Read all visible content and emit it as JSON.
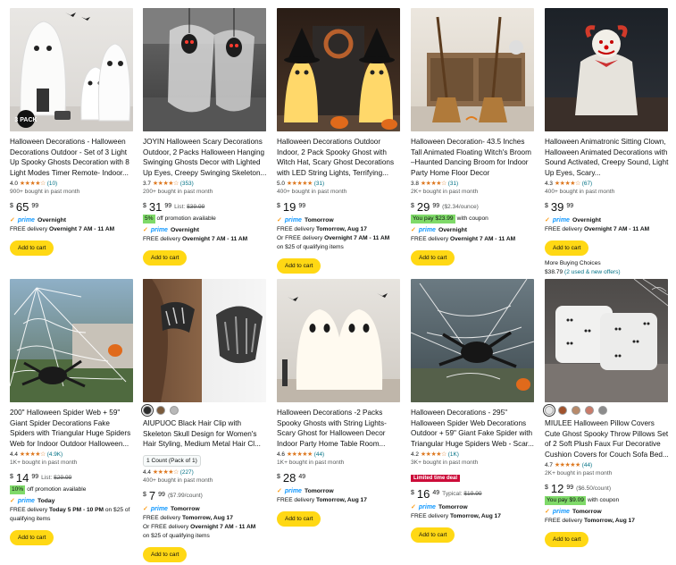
{
  "cards": [
    {
      "title": "Halloween Decorations - Halloween Decorations Outdoor - Set of 3 Light Up Spooky Ghosts Decoration with 8 Light Modes Timer Remote- Indoor...",
      "rating": "4.0",
      "stars": "★★★★☆",
      "reviews": "(10)",
      "bought": "900+ bought in past month",
      "price": {
        "sym": "$",
        "whole": "65",
        "frac": "99"
      },
      "prime": "Overnight",
      "delivery": [
        "FREE delivery ",
        "Overnight 7 AM - 11 AM"
      ],
      "cart": "Add to cart",
      "badge": "3 PACK"
    },
    {
      "title": "JOYIN Halloween Scary Decorations Outdoor, 2 Packs Halloween Hanging Swinging Ghosts Decor with Lighted Up Eyes, Creepy Swinging Skeleton...",
      "rating": "3.7",
      "stars": "★★★★☆",
      "reviews": "(353)",
      "bought": "200+ bought in past month",
      "price": {
        "sym": "$",
        "whole": "31",
        "frac": "99",
        "list": "List: ",
        "list_price": "$39.99"
      },
      "promo": {
        "badge": "5%",
        "text": "off promotion available"
      },
      "prime": "Overnight",
      "delivery": [
        "FREE delivery ",
        "Overnight 7 AM - 11 AM"
      ],
      "cart": "Add to cart"
    },
    {
      "title": "Halloween Decorations Outdoor Indoor, 2 Pack Spooky Ghost with Witch Hat, Scary Ghost Decorations with LED String Lights, Terrifying...",
      "rating": "5.0",
      "stars": "★★★★★",
      "reviews": "(31)",
      "bought": "400+ bought in past month",
      "price": {
        "sym": "$",
        "whole": "19",
        "frac": "99"
      },
      "prime": "Tomorrow",
      "delivery": [
        "FREE delivery ",
        "Tomorrow, Aug 17"
      ],
      "delivery2": [
        "Or FREE delivery ",
        "Overnight 7 AM - 11 AM"
      ],
      "delivery3": "on $25 of qualifying items",
      "cart": "Add to cart"
    },
    {
      "title": "Halloween Decoration- 43.5 Inches Tall Animated Floating Witch's Broom –Haunted Dancing Broom for Indoor Party Home Floor Decor",
      "rating": "3.8",
      "stars": "★★★★☆",
      "reviews": "(31)",
      "bought": "2K+ bought in past month",
      "price": {
        "sym": "$",
        "whole": "29",
        "frac": "99",
        "note": "($2.34/ounce)"
      },
      "promo": {
        "badge": "You pay $23.99",
        "text": "with coupon"
      },
      "prime": "Overnight",
      "delivery": [
        "FREE delivery ",
        "Overnight 7 AM - 11 AM"
      ],
      "cart": "Add to cart"
    },
    {
      "title": "Halloween Animatronic Sitting Clown, Halloween Animated Decorations with Sound Activated, Creepy Sound, Light Up Eyes, Scary...",
      "rating": "4.3",
      "stars": "★★★★☆",
      "reviews": "(67)",
      "bought": "400+ bought in past month",
      "price": {
        "sym": "$",
        "whole": "39",
        "frac": "99"
      },
      "prime": "Overnight",
      "delivery": [
        "FREE delivery ",
        "Overnight 7 AM - 11 AM"
      ],
      "cart": "Add to cart",
      "more_label": "More Buying Choices",
      "more_price": "$38.79",
      "more_link": "(2 used & new offers)"
    },
    {
      "title": "200\" Halloween Spider Web + 59\" Giant Spider Decorations Fake Spiders with Triangular Huge Spiders Web for Indoor Outdoor Halloween...",
      "rating": "4.4",
      "stars": "★★★★☆",
      "reviews": "(4.9K)",
      "bought": "1K+ bought in past month",
      "price": {
        "sym": "$",
        "whole": "14",
        "frac": "99",
        "list": "List: ",
        "list_price": "$29.99"
      },
      "promo": {
        "badge": "10%",
        "text": "off promotion available"
      },
      "prime": "Today",
      "delivery": [
        "FREE delivery ",
        "Today 5 PM - 10 PM"
      ],
      "delivery_tail": " on $25 of qualifying items",
      "cart": "Add to cart"
    },
    {
      "title": "AIUPUOC Black Hair Clip with Skeleton Skull Design for Women's Hair Styling, Medium Metal Hair Cl...",
      "rating": "4.4",
      "stars": "★★★★☆",
      "reviews": "(227)",
      "count": "1 Count (Pack of 1)",
      "bought": "400+ bought in past month",
      "price": {
        "sym": "$",
        "whole": "7",
        "frac": "99",
        "note": "($7.99/count)"
      },
      "prime": "Tomorrow",
      "delivery": [
        "FREE delivery ",
        "Tomorrow, Aug 17"
      ],
      "delivery2": [
        "Or FREE delivery ",
        "Overnight 7 AM - 11 AM"
      ],
      "delivery3": "on $25 of qualifying items",
      "cart": "Add to cart",
      "swatch_colors": [
        "#2b2b2b",
        "#7a5a3c",
        "#b8b8b8"
      ]
    },
    {
      "title": "Halloween Decorations -2 Packs Spooky Ghosts with String Lights- Scary Ghost for Halloween Decor Indoor Party Home Table Room...",
      "rating": "4.6",
      "stars": "★★★★★",
      "reviews": "(44)",
      "bought": "1K+ bought in past month",
      "price": {
        "sym": "$",
        "whole": "28",
        "frac": "49"
      },
      "prime": "Tomorrow",
      "delivery": [
        "FREE delivery ",
        "Tomorrow, Aug 17"
      ],
      "cart": "Add to cart"
    },
    {
      "title": "Halloween Decorations - 295\" Halloween Spider Web Decorations Outdoor + 59\" Giant Fake Spider with Triangular Huge Spiders Web - Scar...",
      "rating": "4.2",
      "stars": "★★★★☆",
      "reviews": "(1K)",
      "bought": "3K+ bought in past month",
      "limited": "Limited time deal",
      "price": {
        "sym": "$",
        "whole": "16",
        "frac": "49",
        "note": "Typical: ",
        "typical": "$19.99"
      },
      "prime": "Tomorrow",
      "delivery": [
        "FREE delivery ",
        "Tomorrow, Aug 17"
      ],
      "cart": "Add to cart"
    },
    {
      "title": "MIULEE Halloween Pillow Covers Cute Ghost Spooky Throw Pillows Set of 2 Soft Plush Faux Fur Decorative Cushion Covers for Couch Sofa Bed...",
      "rating": "4.7",
      "stars": "★★★★★",
      "reviews": "(44)",
      "bought": "2K+ bought in past month",
      "price": {
        "sym": "$",
        "whole": "12",
        "frac": "99",
        "note": "($6.50/count)"
      },
      "promo": {
        "badge": "You pay $9.09",
        "text": "with coupon"
      },
      "prime": "Tomorrow",
      "delivery": [
        "FREE delivery ",
        "Tomorrow, Aug 17"
      ],
      "cart": "Add to cart",
      "swatch_colors": [
        "#e8e8e8",
        "#a0522d",
        "#b88a6a",
        "#c97b6a",
        "#8c8c8c"
      ]
    }
  ],
  "prime_brand": "prime",
  "colors": {
    "cart": "#ffd814",
    "link": "#007185",
    "star": "#de7921",
    "promo": "#7fda69",
    "deal": "#cc0c39",
    "prime": "#1399ff"
  }
}
